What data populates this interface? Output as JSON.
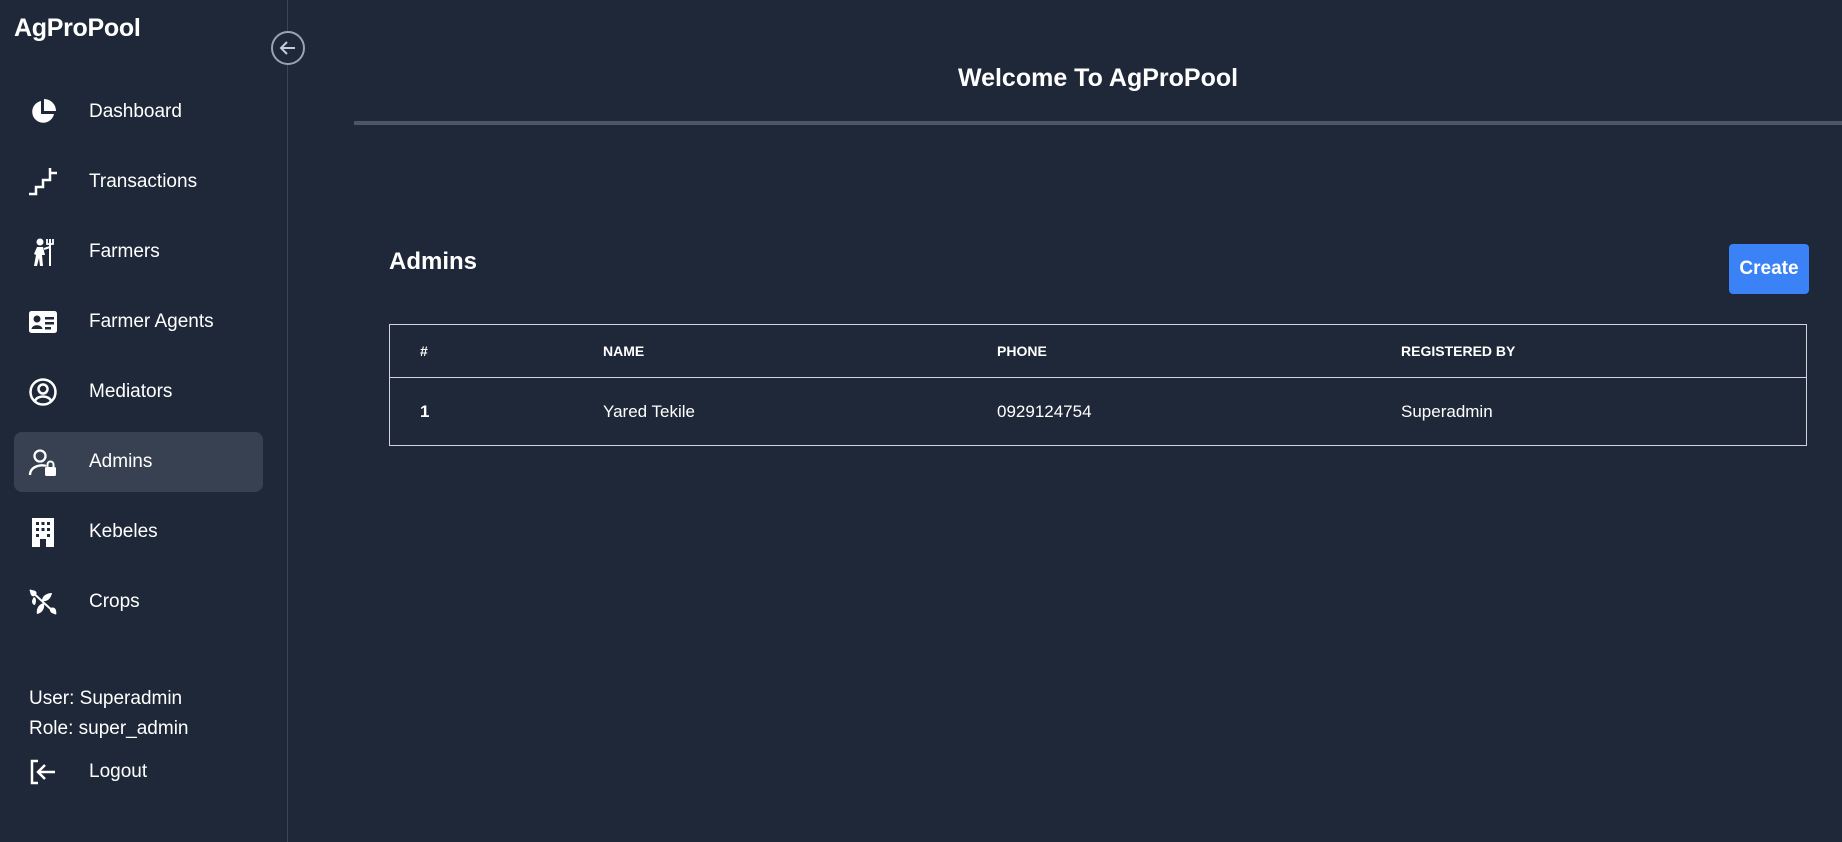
{
  "app": {
    "title": "AgProPool"
  },
  "sidebar": {
    "items": [
      {
        "label": "Dashboard",
        "icon": "pie-chart-icon"
      },
      {
        "label": "Transactions",
        "icon": "stairs-icon"
      },
      {
        "label": "Farmers",
        "icon": "farmer-icon"
      },
      {
        "label": "Farmer Agents",
        "icon": "id-card-icon"
      },
      {
        "label": "Mediators",
        "icon": "user-circle-icon"
      },
      {
        "label": "Admins",
        "icon": "user-lock-icon"
      },
      {
        "label": "Kebeles",
        "icon": "building-icon"
      },
      {
        "label": "Crops",
        "icon": "leaves-icon"
      }
    ],
    "active": "Admins",
    "user": "User: Superadmin",
    "role": "Role: super_admin",
    "logout": "Logout"
  },
  "header": {
    "welcome": "Welcome To AgProPool"
  },
  "main": {
    "title": "Admins",
    "create_label": "Create",
    "table": {
      "headers": [
        "#",
        "NAME",
        "PHONE",
        "REGISTERED BY"
      ],
      "rows": [
        [
          "1",
          "Yared Tekile",
          "0929124754",
          "Superadmin"
        ]
      ]
    }
  },
  "colors": {
    "background": "#1f2838",
    "active_item": "#374151",
    "accent": "#3b82f6"
  }
}
